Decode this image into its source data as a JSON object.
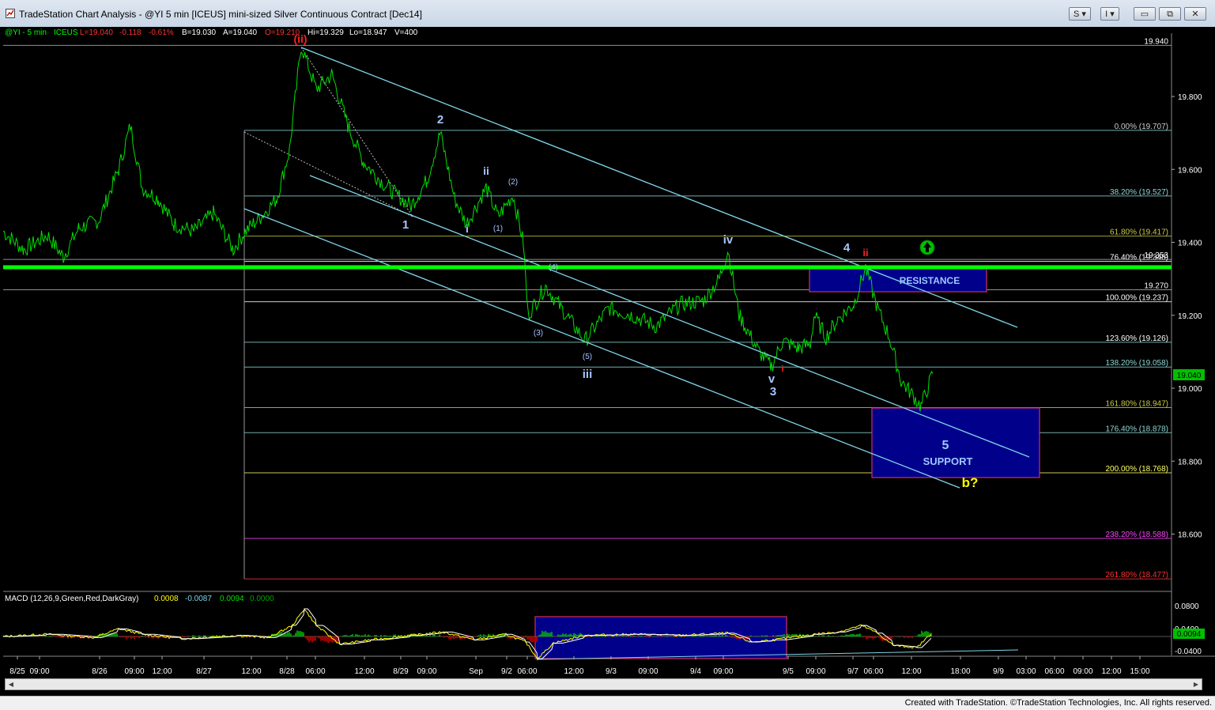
{
  "window": {
    "title": "TradeStation Chart Analysis - @YI 5 min [ICEUS] mini-sized Silver Continuous Contract [Dec14]",
    "buttons": {
      "s_label": "S",
      "i_label": "I",
      "minimize": "▭",
      "restore": "⧉",
      "close": "✕"
    }
  },
  "status": {
    "credit": "Created with TradeStation. ©TradeStation Technologies, Inc. All rights reserved."
  },
  "quote": {
    "symbol": "@YI - 5 min",
    "exchange": "ICEUS",
    "last": "L=19.040",
    "change": "-0.118",
    "pct": "-0.61%",
    "bid": "B=19.030",
    "ask": "A=19.040",
    "open": "O=19.210",
    "high": "Hi=19.329",
    "low": "Lo=18.947",
    "volume": "V=400"
  },
  "macd": {
    "label": "MACD (12,26,9,Green,Red,DarkGray)",
    "v1": "0.0008",
    "v2": "-0.0087",
    "v3": "0.0094",
    "v4": "0.0000",
    "scale": [
      "0.0800",
      "0.0400",
      "-0.0400"
    ],
    "current_label": "0.0094"
  },
  "colors": {
    "price": "#00e000",
    "fib": "#8fd8d8",
    "channel": "#7fd4e6",
    "box": "#00008b",
    "resistance_line": "#00ff00",
    "count_blue": "#a8c4ff",
    "count_red": "#ff2020",
    "yellow": "#ffff00"
  },
  "chart_data": {
    "type": "line",
    "title": "",
    "symbol": "@YI",
    "interval": "5 min",
    "ylim": [
      18.44,
      20.0
    ],
    "y_ticks": [
      "19.800",
      "19.600",
      "19.400",
      "19.200",
      "19.000",
      "18.800",
      "18.600"
    ],
    "x_labels": [
      "8/25",
      "09:00",
      "8/26",
      "09:00",
      "12:00",
      "8/27",
      "12:00",
      "8/28",
      "06:00",
      "12:00",
      "8/29",
      "09:00",
      "Sep",
      "9/2",
      "06:00",
      "12:00",
      "9/3",
      "09:00",
      "9/4",
      "09:00",
      "9/5",
      "09:00",
      "9/7",
      "06:00",
      "12:00",
      "18:00",
      "9/9",
      "03:00",
      "06:00",
      "09:00",
      "12:00",
      "15:00"
    ],
    "last_price": "19.040",
    "levels": [
      {
        "price": 19.94,
        "label": "19.940"
      },
      {
        "price": 19.27,
        "label": "19.270"
      },
      {
        "price": 19.353,
        "label": "19.353"
      }
    ],
    "fib_levels": [
      {
        "label": "0.00% (19.707)",
        "price": 19.707
      },
      {
        "label": "38.20% (19.527)",
        "price": 19.527
      },
      {
        "label": "61.80% (19.417)",
        "price": 19.417
      },
      {
        "label": "76.40% (19.348)",
        "price": 19.348
      },
      {
        "label": "100.00% (19.237)",
        "price": 19.237
      },
      {
        "label": "123.60% (19.126)",
        "price": 19.126
      },
      {
        "label": "138.20% (19.058)",
        "price": 19.058
      },
      {
        "label": "161.80% (18.947)",
        "price": 18.947
      },
      {
        "label": "176.40% (18.878)",
        "price": 18.878
      },
      {
        "label": "200.00% (18.768)",
        "price": 18.768
      },
      {
        "label": "238.20% (18.588)",
        "price": 18.588
      },
      {
        "label": "261.80% (18.477)",
        "price": 18.477
      }
    ],
    "wave_labels": [
      "(ii)",
      "1",
      "2",
      "i",
      "ii",
      "(1)",
      "(2)",
      "(3)",
      "(4)",
      "(5)",
      "iii",
      "iv",
      "v",
      "3",
      "i",
      "4",
      "ii",
      "5",
      "b?"
    ],
    "zones": [
      {
        "name": "RESISTANCE",
        "top": 19.33,
        "bottom": 19.27
      },
      {
        "name": "SUPPORT",
        "top": 18.95,
        "bottom": 18.745
      }
    ]
  }
}
